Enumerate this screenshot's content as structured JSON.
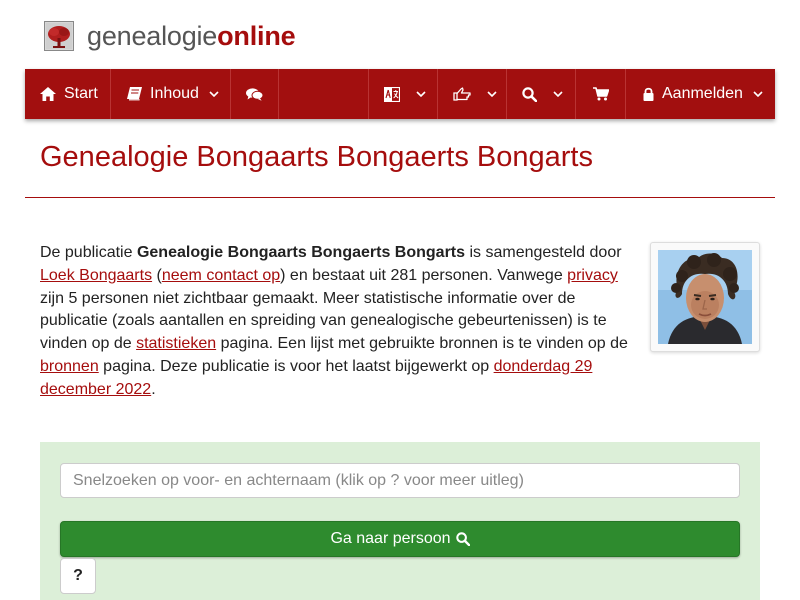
{
  "brand": {
    "name_plain": "genealogie",
    "name_accent": "online",
    "accent_color": "#a50d0d",
    "logo_icon": "tree-icon"
  },
  "nav": {
    "background": "#a20f0f",
    "start_label": "Start",
    "start_icon": "home-icon",
    "inhoud_label": "Inhoud",
    "inhoud_icon": "book-icon",
    "chat_icon": "comments-icon",
    "language_icon": "language-icon",
    "share_icon": "share-icon",
    "search_icon": "search-icon",
    "cart_icon": "cart-icon",
    "login_label": "Aanmelden",
    "login_icon": "lock-icon"
  },
  "page": {
    "title": "Genealogie Bongaarts Bongaerts Bongarts"
  },
  "intro": {
    "t1": "De publicatie ",
    "publication_name": "Genealogie Bongaarts Bongaerts Bongarts",
    "t2": " is samengesteld door ",
    "author_link": "Loek Bongaarts",
    "t3": " (",
    "contact_link": "neem contact op",
    "t4": ") en bestaat uit 281 personen. Vanwege ",
    "privacy_link": "privacy",
    "t5": " zijn 5 personen niet zichtbaar gemaakt. Meer statistische informatie over de publicatie (zoals aantallen en spreiding van genealogische gebeurtenissen) is te vinden op de ",
    "stats_link": "statistieken",
    "t6": " pagina. Een lijst met gebruikte bronnen is te vinden op de ",
    "sources_link": "bronnen",
    "t7": " pagina. Deze publicatie is voor het laatst bijgewerkt op ",
    "date_link": "donderdag 29 december 2022",
    "t8": "."
  },
  "search": {
    "placeholder": "Snelzoeken op voor- en achternaam (klik op ? voor meer uitleg)",
    "value": "",
    "go_label": "Ga naar persoon",
    "help_label": "?",
    "panel_color": "#dcefd8",
    "button_color": "#2e8b2e"
  }
}
